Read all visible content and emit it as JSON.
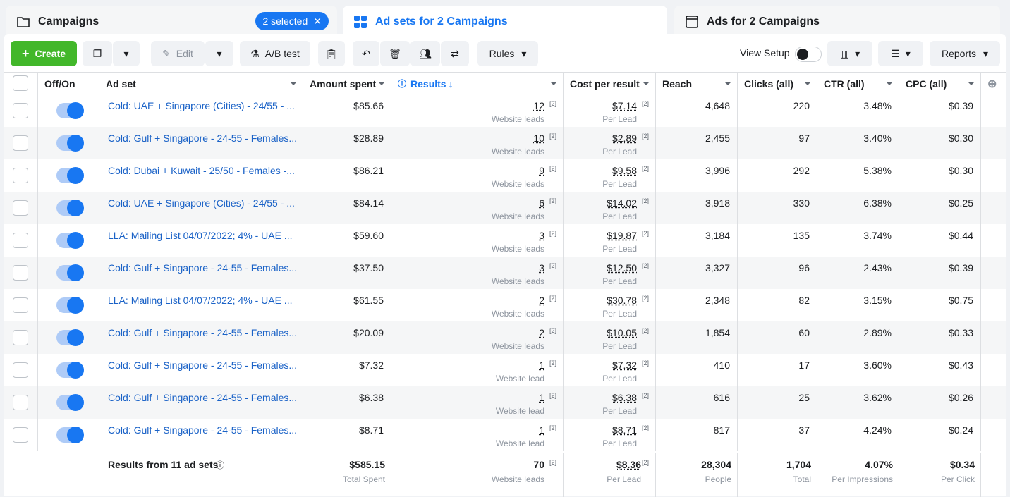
{
  "tabs": {
    "campaigns": "Campaigns",
    "selected_badge": "2 selected",
    "adsets": "Ad sets for 2 Campaigns",
    "ads": "Ads for 2 Campaigns"
  },
  "toolbar": {
    "create": "Create",
    "edit": "Edit",
    "ab_test": "A/B test",
    "rules": "Rules",
    "view_setup": "View Setup",
    "reports": "Reports"
  },
  "columns": [
    "Off/On",
    "Ad set",
    "Amount spent",
    "Results",
    "Cost per result",
    "Reach",
    "Clicks (all)",
    "CTR (all)",
    "CPC (all)"
  ],
  "rows": [
    {
      "name": "Cold: UAE + Singapore (Cities) - 24/55 - ...",
      "spent": "$85.66",
      "results": "12",
      "results_label": "Website leads",
      "cpr": "$7.14",
      "cpr_label": "Per Lead",
      "reach": "4,648",
      "clicks": "220",
      "ctr": "3.48%",
      "cpc": "$0.39"
    },
    {
      "name": "Cold: Gulf + Singapore - 24-55 - Females...",
      "spent": "$28.89",
      "results": "10",
      "results_label": "Website leads",
      "cpr": "$2.89",
      "cpr_label": "Per Lead",
      "reach": "2,455",
      "clicks": "97",
      "ctr": "3.40%",
      "cpc": "$0.30"
    },
    {
      "name": "Cold: Dubai + Kuwait - 25/50 - Females -...",
      "spent": "$86.21",
      "results": "9",
      "results_label": "Website leads",
      "cpr": "$9.58",
      "cpr_label": "Per Lead",
      "reach": "3,996",
      "clicks": "292",
      "ctr": "5.38%",
      "cpc": "$0.30"
    },
    {
      "name": "Cold: UAE + Singapore (Cities) - 24/55 - ...",
      "spent": "$84.14",
      "results": "6",
      "results_label": "Website leads",
      "cpr": "$14.02",
      "cpr_label": "Per Lead",
      "reach": "3,918",
      "clicks": "330",
      "ctr": "6.38%",
      "cpc": "$0.25"
    },
    {
      "name": "LLA: Mailing List 04/07/2022; 4% - UAE ...",
      "spent": "$59.60",
      "results": "3",
      "results_label": "Website leads",
      "cpr": "$19.87",
      "cpr_label": "Per Lead",
      "reach": "3,184",
      "clicks": "135",
      "ctr": "3.74%",
      "cpc": "$0.44"
    },
    {
      "name": "Cold: Gulf + Singapore - 24-55 - Females...",
      "spent": "$37.50",
      "results": "3",
      "results_label": "Website leads",
      "cpr": "$12.50",
      "cpr_label": "Per Lead",
      "reach": "3,327",
      "clicks": "96",
      "ctr": "2.43%",
      "cpc": "$0.39"
    },
    {
      "name": "LLA: Mailing List 04/07/2022; 4% - UAE ...",
      "spent": "$61.55",
      "results": "2",
      "results_label": "Website leads",
      "cpr": "$30.78",
      "cpr_label": "Per Lead",
      "reach": "2,348",
      "clicks": "82",
      "ctr": "3.15%",
      "cpc": "$0.75"
    },
    {
      "name": "Cold: Gulf + Singapore - 24-55 - Females...",
      "spent": "$20.09",
      "results": "2",
      "results_label": "Website leads",
      "cpr": "$10.05",
      "cpr_label": "Per Lead",
      "reach": "1,854",
      "clicks": "60",
      "ctr": "2.89%",
      "cpc": "$0.33"
    },
    {
      "name": "Cold: Gulf + Singapore - 24-55 - Females...",
      "spent": "$7.32",
      "results": "1",
      "results_label": "Website lead",
      "cpr": "$7.32",
      "cpr_label": "Per Lead",
      "reach": "410",
      "clicks": "17",
      "ctr": "3.60%",
      "cpc": "$0.43"
    },
    {
      "name": "Cold: Gulf + Singapore - 24-55 - Females...",
      "spent": "$6.38",
      "results": "1",
      "results_label": "Website lead",
      "cpr": "$6.38",
      "cpr_label": "Per Lead",
      "reach": "616",
      "clicks": "25",
      "ctr": "3.62%",
      "cpc": "$0.26"
    },
    {
      "name": "Cold: Gulf + Singapore - 24-55 - Females...",
      "spent": "$8.71",
      "results": "1",
      "results_label": "Website lead",
      "cpr": "$8.71",
      "cpr_label": "Per Lead",
      "reach": "817",
      "clicks": "37",
      "ctr": "4.24%",
      "cpc": "$0.24"
    }
  ],
  "footnote": "[2]",
  "totals": {
    "label": "Results from 11 ad sets",
    "spent": "$585.15",
    "spent_label": "Total Spent",
    "results": "70",
    "results_label": "Website leads",
    "cpr": "$8.36",
    "cpr_label": "Per Lead",
    "reach": "28,304",
    "reach_label": "People",
    "clicks": "1,704",
    "clicks_label": "Total",
    "ctr": "4.07%",
    "ctr_label": "Per Impressions",
    "cpc": "$0.34",
    "cpc_label": "Per Click"
  }
}
